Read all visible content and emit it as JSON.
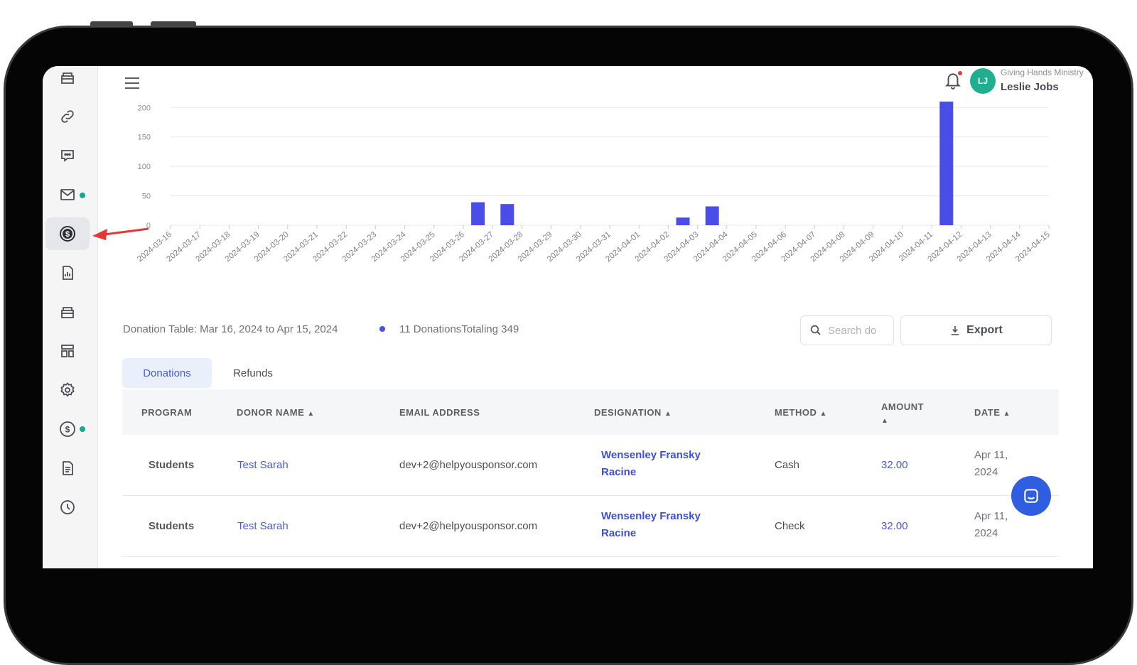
{
  "header": {
    "organization": "Giving Hands Ministry",
    "user_name": "Leslie Jobs",
    "avatar_initials": "LJ"
  },
  "sidebar": {
    "items": [
      {
        "icon": "box-icon"
      },
      {
        "icon": "link-icon"
      },
      {
        "icon": "chat-icon"
      },
      {
        "icon": "mail-icon",
        "dot": true
      },
      {
        "icon": "dollar-icon",
        "active": true
      },
      {
        "icon": "report-icon"
      },
      {
        "icon": "box-icon"
      },
      {
        "icon": "layout-icon"
      },
      {
        "icon": "gear-icon"
      },
      {
        "icon": "dollar-icon",
        "dot": true
      },
      {
        "icon": "document-icon"
      },
      {
        "icon": "clock-icon"
      }
    ]
  },
  "chart_data": {
    "type": "bar",
    "categories": [
      "2024-03-16",
      "2024-03-17",
      "2024-03-18",
      "2024-03-19",
      "2024-03-20",
      "2024-03-21",
      "2024-03-22",
      "2024-03-23",
      "2024-03-24",
      "2024-03-25",
      "2024-03-26",
      "2024-03-27",
      "2024-03-28",
      "2024-03-29",
      "2024-03-30",
      "2024-03-31",
      "2024-04-01",
      "2024-04-02",
      "2024-04-03",
      "2024-04-04",
      "2024-04-05",
      "2024-04-06",
      "2024-04-07",
      "2024-04-08",
      "2024-04-09",
      "2024-04-10",
      "2024-04-11",
      "2024-04-12",
      "2024-04-13",
      "2024-04-14",
      "2024-04-15"
    ],
    "values": [
      0,
      0,
      0,
      0,
      0,
      0,
      0,
      0,
      0,
      0,
      39,
      36,
      0,
      0,
      0,
      0,
      0,
      13,
      32,
      0,
      0,
      0,
      0,
      0,
      0,
      0,
      210,
      0,
      0,
      0,
      0
    ],
    "yticks": [
      0,
      50,
      100,
      150,
      200
    ],
    "ylim": [
      0,
      210
    ],
    "color": "#4a4de6",
    "grid": true
  },
  "table_summary": {
    "label": "Donation Table: Mar 16, 2024 to Apr 15, 2024",
    "totals": "11 DonationsTotaling 349"
  },
  "search": {
    "placeholder": "Search do"
  },
  "export_label": "Export",
  "tabs": [
    {
      "label": "Donations",
      "active": true
    },
    {
      "label": "Refunds",
      "active": false
    }
  ],
  "columns": {
    "program": "PROGRAM",
    "donor": "DONOR NAME",
    "email": "EMAIL ADDRESS",
    "designation": "DESIGNATION",
    "method": "METHOD",
    "amount": "AMOUNT",
    "date": "DATE"
  },
  "rows": [
    {
      "program": "Students",
      "donor": "Test Sarah",
      "email": "dev+2@helpyousponsor.com",
      "designation_1": "Wensenley Fransky",
      "designation_2": "Racine",
      "method": "Cash",
      "amount": "32.00",
      "date_1": "Apr 11,",
      "date_2": "2024"
    },
    {
      "program": "Students",
      "donor": "Test Sarah",
      "email": "dev+2@helpyousponsor.com",
      "designation_1": "Wensenley Fransky",
      "designation_2": "Racine",
      "method": "Check",
      "amount": "32.00",
      "date_1": "Apr 11,",
      "date_2": "2024"
    }
  ]
}
